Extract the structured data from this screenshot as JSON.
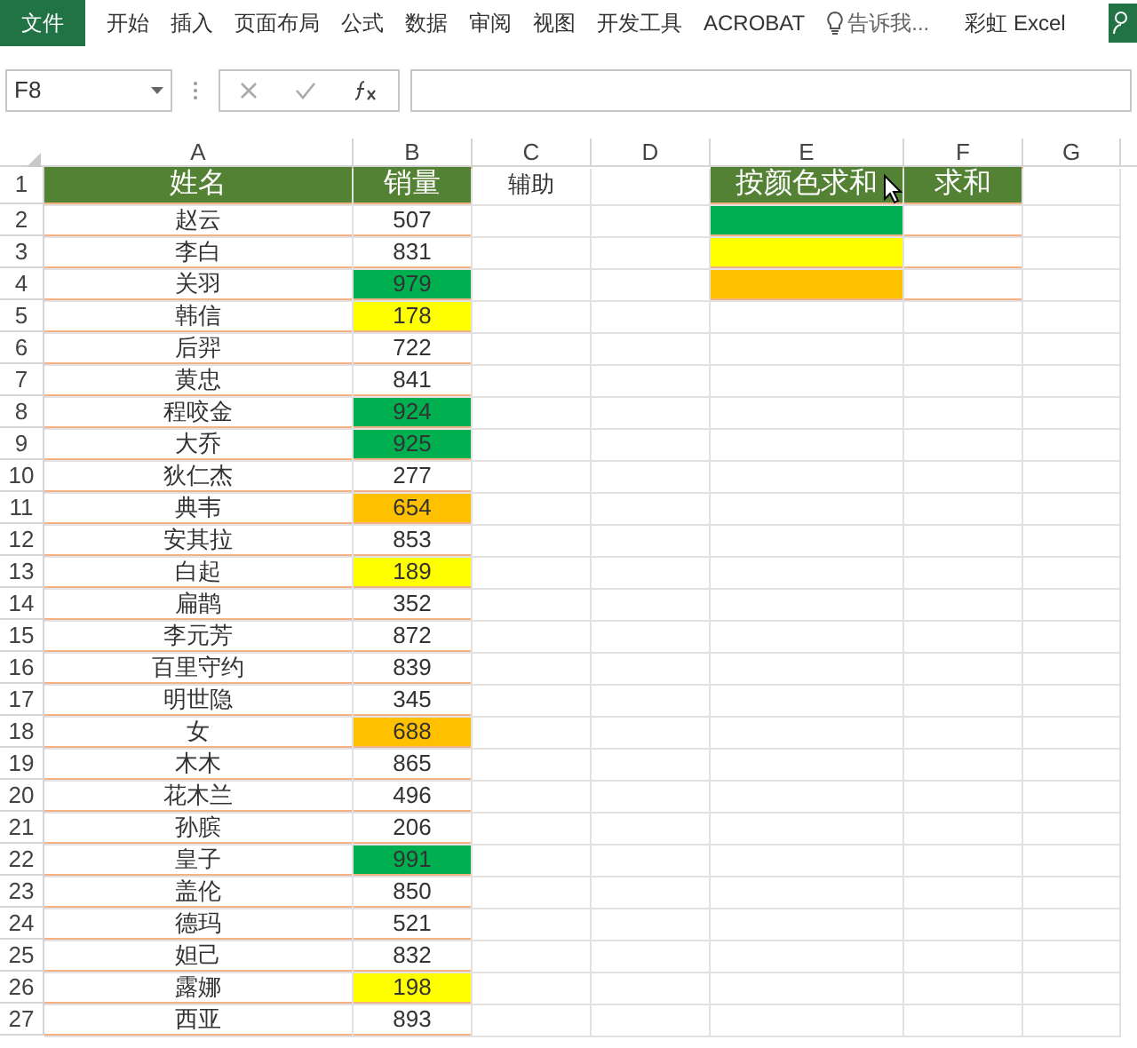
{
  "ribbon": {
    "tabs": [
      {
        "label": "文件",
        "selected": true
      },
      {
        "label": "开始",
        "selected": false
      },
      {
        "label": "插入",
        "selected": false
      },
      {
        "label": "页面布局",
        "selected": false
      },
      {
        "label": "公式",
        "selected": false
      },
      {
        "label": "数据",
        "selected": false
      },
      {
        "label": "审阅",
        "selected": false
      },
      {
        "label": "视图",
        "selected": false
      },
      {
        "label": "开发工具",
        "selected": false
      },
      {
        "label": "ACROBAT",
        "selected": false
      }
    ],
    "tell_me": "告诉我...",
    "user": "彩虹 Excel"
  },
  "formula_bar": {
    "name_box": "F8"
  },
  "sheet": {
    "columns": [
      "A",
      "B",
      "C",
      "D",
      "E",
      "F",
      "G"
    ],
    "header": {
      "name": "姓名",
      "sales": "销量",
      "helper": "辅助",
      "color_sum": "按颜色求和",
      "sum": "求和"
    },
    "row_numbers": [
      "1",
      "2",
      "3",
      "4",
      "5",
      "6",
      "7",
      "8",
      "9",
      "10",
      "11",
      "12",
      "13",
      "14",
      "15",
      "16",
      "17",
      "18",
      "19",
      "20",
      "21",
      "22",
      "23",
      "24",
      "25",
      "26",
      "27"
    ],
    "color_keys": [
      {
        "color": "#00b050"
      },
      {
        "color": "#ffff00"
      },
      {
        "color": "#ffc000"
      }
    ],
    "rows": [
      {
        "name": "赵云",
        "sales": "507"
      },
      {
        "name": "李白",
        "sales": "831"
      },
      {
        "name": "关羽",
        "sales": "979",
        "color": "#00b050"
      },
      {
        "name": "韩信",
        "sales": "178",
        "color": "#ffff00"
      },
      {
        "name": "后羿",
        "sales": "722"
      },
      {
        "name": "黄忠",
        "sales": "841"
      },
      {
        "name": "程咬金",
        "sales": "924",
        "color": "#00b050"
      },
      {
        "name": "大乔",
        "sales": "925",
        "color": "#00b050"
      },
      {
        "name": "狄仁杰",
        "sales": "277"
      },
      {
        "name": "典韦",
        "sales": "654",
        "color": "#ffc000"
      },
      {
        "name": "安其拉",
        "sales": "853"
      },
      {
        "name": "白起",
        "sales": "189",
        "color": "#ffff00"
      },
      {
        "name": "扁鹊",
        "sales": "352"
      },
      {
        "name": "李元芳",
        "sales": "872"
      },
      {
        "name": "百里守约",
        "sales": "839"
      },
      {
        "name": "明世隐",
        "sales": "345"
      },
      {
        "name": "女",
        "sales": "688",
        "color": "#ffc000"
      },
      {
        "name": "木木",
        "sales": "865"
      },
      {
        "name": "花木兰",
        "sales": "496"
      },
      {
        "name": "孙膑",
        "sales": "206"
      },
      {
        "name": "皇子",
        "sales": "991",
        "color": "#00b050"
      },
      {
        "name": "盖伦",
        "sales": "850"
      },
      {
        "name": "德玛",
        "sales": "521"
      },
      {
        "name": "妲己",
        "sales": "832"
      },
      {
        "name": "露娜",
        "sales": "198",
        "color": "#ffff00"
      },
      {
        "name": "西亚",
        "sales": "893"
      }
    ]
  }
}
